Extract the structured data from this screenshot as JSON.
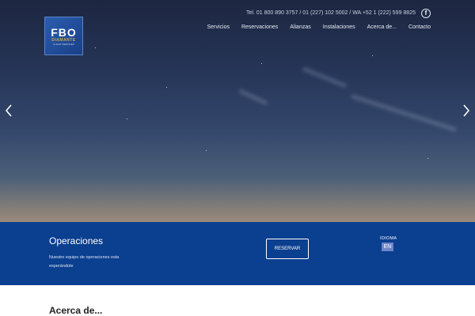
{
  "header": {
    "logo": {
      "main": "FBO",
      "sub": "DIAMANTE",
      "tag": "FLIGHT SERVICES"
    },
    "contact": "Tel. 01 800 890 3757 / 01 (227) 102 5002 / WA +52 1 (222) 599 8825",
    "social_icon": "facebook-icon",
    "social_glyph": "f"
  },
  "nav": {
    "items": [
      {
        "label": "Servicios"
      },
      {
        "label": "Reservaciones"
      },
      {
        "label": "Alianzas"
      },
      {
        "label": "Instalaciones"
      },
      {
        "label": "Acerca de..."
      },
      {
        "label": "Contacto"
      }
    ]
  },
  "slider": {
    "prev_icon": "chevron-left-icon",
    "next_icon": "chevron-right-icon"
  },
  "band": {
    "title": "Operaciones",
    "text": "Nuestro equipo de operaciones esta esperándote",
    "reserve_label": "RESERVAR",
    "language_label": "IDIOMA",
    "language_option": "EN",
    "background": "#0b3f8f"
  },
  "about": {
    "heading": "Acerca de..."
  }
}
